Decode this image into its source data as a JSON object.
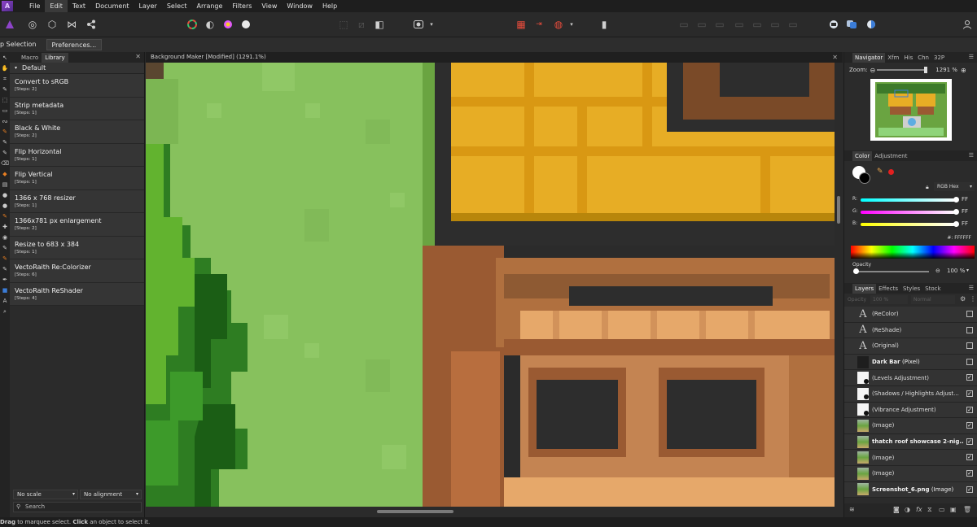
{
  "menubar": {
    "logo_glyph": "A",
    "items": [
      "File",
      "Edit",
      "Text",
      "Document",
      "Layer",
      "Select",
      "Arrange",
      "Filters",
      "View",
      "Window",
      "Help"
    ]
  },
  "context_bar": {
    "selection_label": "p Selection",
    "preferences_label": "Preferences..."
  },
  "left_panel": {
    "tabs": [
      "Macro",
      "Library"
    ],
    "category": "Default",
    "macros": [
      {
        "name": "Convert to sRGB",
        "steps": "[Steps: 2]"
      },
      {
        "name": "Strip metadata",
        "steps": "[Steps: 1]"
      },
      {
        "name": "Black & White",
        "steps": "[Steps: 2]"
      },
      {
        "name": "Flip Horizontal",
        "steps": "[Steps: 1]"
      },
      {
        "name": "Flip Vertical",
        "steps": "[Steps: 1]"
      },
      {
        "name": "1366 x 768 resizer",
        "steps": "[Steps: 1]"
      },
      {
        "name": "1366x781 px enlargement",
        "steps": "[Steps: 2]"
      },
      {
        "name": "Resize to 683 x 384",
        "steps": "[Steps: 1]"
      },
      {
        "name": "VectoRaith Re:Colorizer",
        "steps": "[Steps: 6]"
      },
      {
        "name": "VectoRaith ReShader",
        "steps": "[Steps: 4]"
      }
    ],
    "scale_option": "No scale",
    "alignment_option": "No alignment",
    "search_placeholder": "Search"
  },
  "document": {
    "title": "Background Maker [Modified] (1291.1%)"
  },
  "navigator": {
    "tabs": [
      "Navigator",
      "Xfm",
      "His",
      "Chn",
      "32P"
    ],
    "zoom_label": "Zoom:",
    "zoom_value": "1291 %"
  },
  "color": {
    "tabs": [
      "Color",
      "Adjustment"
    ],
    "mode": "RGB Hex",
    "r_label": "R:",
    "r_value": "FF",
    "g_label": "G:",
    "g_value": "FF",
    "b_label": "B:",
    "b_value": "FF",
    "hex_value": "#: FFFFFF",
    "opacity_label": "Opacity",
    "opacity_value": "100 %"
  },
  "layers": {
    "tabs": [
      "Layers",
      "Effects",
      "Styles",
      "Stock"
    ],
    "opacity_field": "100 %",
    "blend_mode": "Normal",
    "opacity_prefix": "Opacity",
    "items": [
      {
        "name": "(ReColor)",
        "thumb": "text",
        "checked": false
      },
      {
        "name": "(ReShade)",
        "thumb": "text",
        "checked": false
      },
      {
        "name": "(Original)",
        "thumb": "text",
        "checked": false
      },
      {
        "name": "Dark Bar",
        "suffix": "(Pixel)",
        "thumb": "dark",
        "checked": false
      },
      {
        "name": "(Levels Adjustment)",
        "thumb": "adj",
        "checked": true
      },
      {
        "name": "(Shadows / Highlights Adjust...",
        "thumb": "adj",
        "checked": true
      },
      {
        "name": "(Vibrance Adjustment)",
        "thumb": "adj",
        "checked": true
      },
      {
        "name": "(Image)",
        "thumb": "image",
        "checked": true
      },
      {
        "name": "thatch roof showcase 2-nig...",
        "thumb": "image",
        "checked": true
      },
      {
        "name": "(Image)",
        "thumb": "image",
        "checked": true
      },
      {
        "name": "(Image)",
        "thumb": "image",
        "checked": true
      },
      {
        "name": "Screenshot_6.png",
        "suffix": "(Image)",
        "thumb": "image",
        "checked": true
      }
    ]
  },
  "status": {
    "drag": "Drag",
    "text1": " to marquee select. ",
    "click": "Click",
    "text2": " an object to select it."
  }
}
